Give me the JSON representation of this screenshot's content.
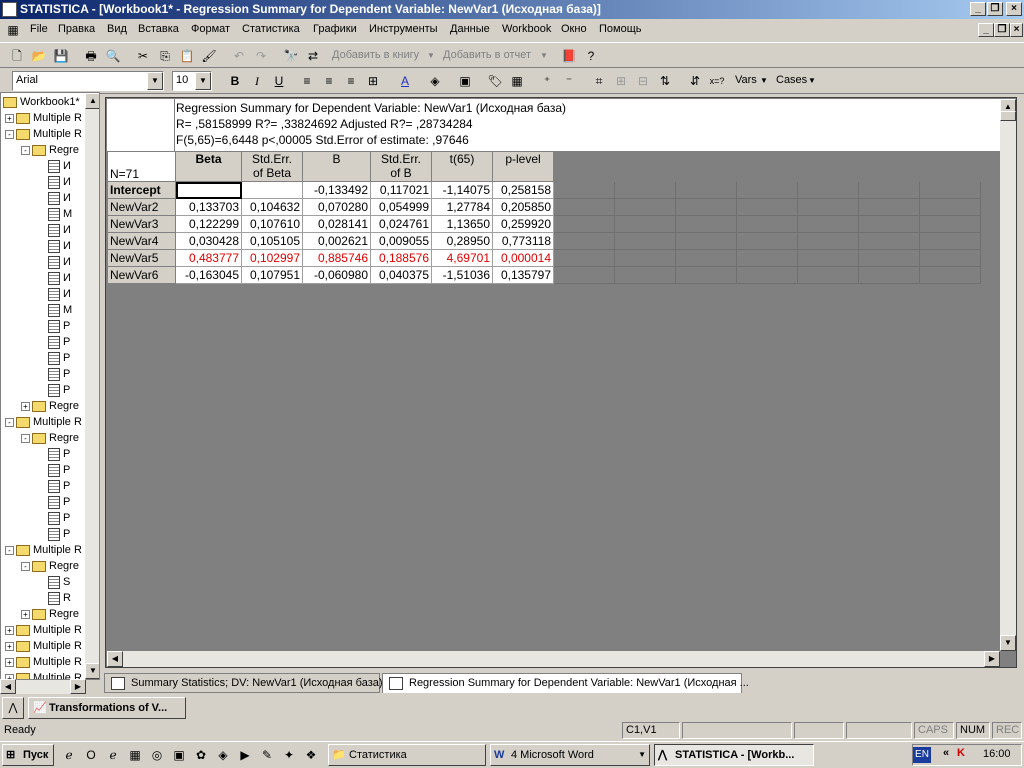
{
  "window": {
    "title": "STATISTICA - [Workbook1* - Regression Summary for Dependent Variable: NewVar1 (Исходная база)]"
  },
  "menu": [
    "File",
    "Правка",
    "Вид",
    "Вставка",
    "Формат",
    "Статистика",
    "Графики",
    "Инструменты",
    "Данные",
    "Workbook",
    "Окно",
    "Помощь"
  ],
  "toolbar": {
    "add_to_book": "Добавить в книгу",
    "add_to_report": "Добавить в отчет",
    "vars": "Vars",
    "cases": "Cases",
    "font": "Arial",
    "size": "10"
  },
  "tree": {
    "root": "Workbook1*",
    "nodes": [
      {
        "label": "Multiple R",
        "level": 1,
        "kind": "folder",
        "exp": "+"
      },
      {
        "label": "Multiple R",
        "level": 1,
        "kind": "folder",
        "exp": "-"
      },
      {
        "label": "Regre",
        "level": 2,
        "kind": "folder",
        "exp": "-"
      },
      {
        "label": "И",
        "level": 3,
        "kind": "doc"
      },
      {
        "label": "И",
        "level": 3,
        "kind": "doc"
      },
      {
        "label": "И",
        "level": 3,
        "kind": "doc"
      },
      {
        "label": "М",
        "level": 3,
        "kind": "doc"
      },
      {
        "label": "И",
        "level": 3,
        "kind": "doc"
      },
      {
        "label": "И",
        "level": 3,
        "kind": "doc"
      },
      {
        "label": "И",
        "level": 3,
        "kind": "doc"
      },
      {
        "label": "И",
        "level": 3,
        "kind": "doc"
      },
      {
        "label": "И",
        "level": 3,
        "kind": "doc"
      },
      {
        "label": "М",
        "level": 3,
        "kind": "doc"
      },
      {
        "label": "P",
        "level": 3,
        "kind": "doc"
      },
      {
        "label": "P",
        "level": 3,
        "kind": "doc"
      },
      {
        "label": "P",
        "level": 3,
        "kind": "doc"
      },
      {
        "label": "P",
        "level": 3,
        "kind": "doc"
      },
      {
        "label": "P",
        "level": 3,
        "kind": "doc"
      },
      {
        "label": "Regre",
        "level": 2,
        "kind": "folder",
        "exp": "+"
      },
      {
        "label": "Multiple R",
        "level": 1,
        "kind": "folder",
        "exp": "-"
      },
      {
        "label": "Regre",
        "level": 2,
        "kind": "folder",
        "exp": "-"
      },
      {
        "label": "P",
        "level": 3,
        "kind": "doc"
      },
      {
        "label": "P",
        "level": 3,
        "kind": "doc"
      },
      {
        "label": "P",
        "level": 3,
        "kind": "doc"
      },
      {
        "label": "P",
        "level": 3,
        "kind": "doc"
      },
      {
        "label": "P",
        "level": 3,
        "kind": "doc"
      },
      {
        "label": "P",
        "level": 3,
        "kind": "doc"
      },
      {
        "label": "Multiple R",
        "level": 1,
        "kind": "folder",
        "exp": "-"
      },
      {
        "label": "Regre",
        "level": 2,
        "kind": "folder",
        "exp": "-"
      },
      {
        "label": "S",
        "level": 3,
        "kind": "doc"
      },
      {
        "label": "R",
        "level": 3,
        "kind": "doc"
      },
      {
        "label": "Regre",
        "level": 2,
        "kind": "folder",
        "exp": "+"
      },
      {
        "label": "Multiple R",
        "level": 1,
        "kind": "folder",
        "exp": "+"
      },
      {
        "label": "Multiple R",
        "level": 1,
        "kind": "folder",
        "exp": "+"
      },
      {
        "label": "Multiple R",
        "level": 1,
        "kind": "folder",
        "exp": "+"
      },
      {
        "label": "Multiple R",
        "level": 1,
        "kind": "folder",
        "exp": "+"
      }
    ]
  },
  "sheet": {
    "header_lines": [
      "Regression Summary for Dependent Variable: NewVar1 (Исходная база)",
      "R= ,58158999 R?= ,33824692 Adjusted R?= ,28734284",
      "F(5,65)=6,6448 p<,00005 Std.Error of estimate: ,97646"
    ],
    "n_label": "N=71",
    "columns": [
      {
        "l1": "Beta",
        "l2": "",
        "bold": true
      },
      {
        "l1": "Std.Err.",
        "l2": "of Beta"
      },
      {
        "l1": "B",
        "l2": ""
      },
      {
        "l1": "Std.Err.",
        "l2": "of B"
      },
      {
        "l1": "t(65)",
        "l2": ""
      },
      {
        "l1": "p-level",
        "l2": ""
      }
    ],
    "rows": [
      {
        "name": "Intercept",
        "bold": true,
        "cells": [
          "",
          "",
          "-0,133492",
          "0,117021",
          "-1,14075",
          "0,258158"
        ]
      },
      {
        "name": "NewVar2",
        "cells": [
          "0,133703",
          "0,104632",
          "0,070280",
          "0,054999",
          "1,27784",
          "0,205850"
        ]
      },
      {
        "name": "NewVar3",
        "cells": [
          "0,122299",
          "0,107610",
          "0,028141",
          "0,024761",
          "1,13650",
          "0,259920"
        ]
      },
      {
        "name": "NewVar4",
        "cells": [
          "0,030428",
          "0,105105",
          "0,002621",
          "0,009055",
          "0,28950",
          "0,773118"
        ]
      },
      {
        "name": "NewVar5",
        "highlight": true,
        "cells": [
          "0,483777",
          "0,102997",
          "0,885746",
          "0,188576",
          "4,69701",
          "0,000014"
        ]
      },
      {
        "name": "NewVar6",
        "cells": [
          "-0,163045",
          "0,107951",
          "-0,060980",
          "0,040375",
          "-1,51036",
          "0,135797"
        ]
      }
    ],
    "highlight_color": "#e00000"
  },
  "tabs": [
    "Summary Statistics; DV: NewVar1 (Исходная база)",
    "Regression Summary for Dependent Variable: NewVar1 (Исходная ..."
  ],
  "task_window": "Transformations of V...",
  "status": {
    "ready": "Ready",
    "cell": "C1,V1",
    "caps": "CAPS",
    "num": "NUM",
    "rec": "REC"
  },
  "taskbar": {
    "start": "Пуск",
    "items": [
      "Статистика",
      "4 Microsoft Word",
      "STATISTICA - [Workb..."
    ],
    "lang": "EN",
    "clock": "16:00"
  }
}
